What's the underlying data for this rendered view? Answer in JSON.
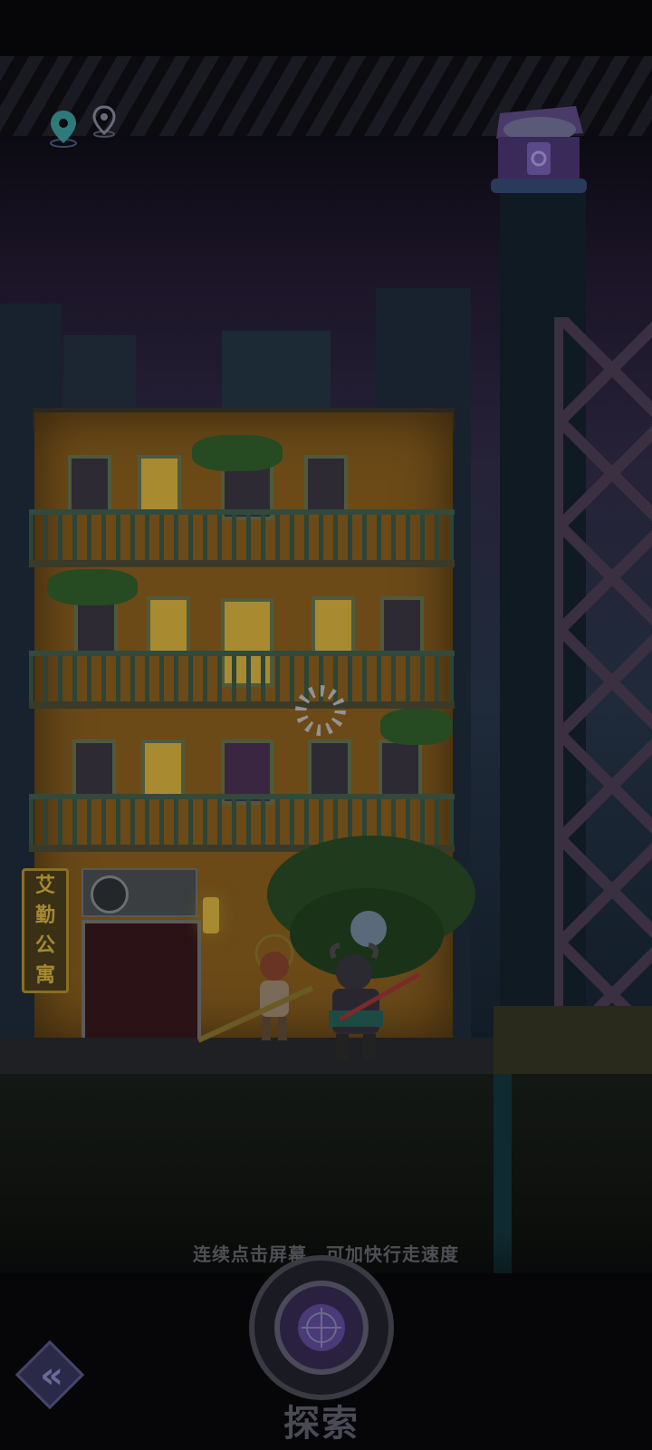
{
  "hud": {
    "location_pins": [
      {
        "icon": "map-pin-icon",
        "state": "active",
        "color": "#3a8a8a"
      },
      {
        "icon": "map-pin-icon",
        "state": "inactive",
        "color": "#6a6a78"
      }
    ],
    "reward_chest": {
      "icon": "treasure-chest-icon"
    }
  },
  "scene": {
    "building_sign": [
      "艾",
      "勤",
      "公",
      "寓"
    ]
  },
  "hint_text": "连续点击屏幕，可加快行走速度",
  "explore_button": {
    "label": "探索",
    "icon": "crosshair-icon"
  },
  "back_button": {
    "icon": "double-chevron-left-icon"
  },
  "colors": {
    "accent_purple": "#4a3a78",
    "building_wall": "#6b4a18",
    "balcony_green": "#324a3c"
  }
}
